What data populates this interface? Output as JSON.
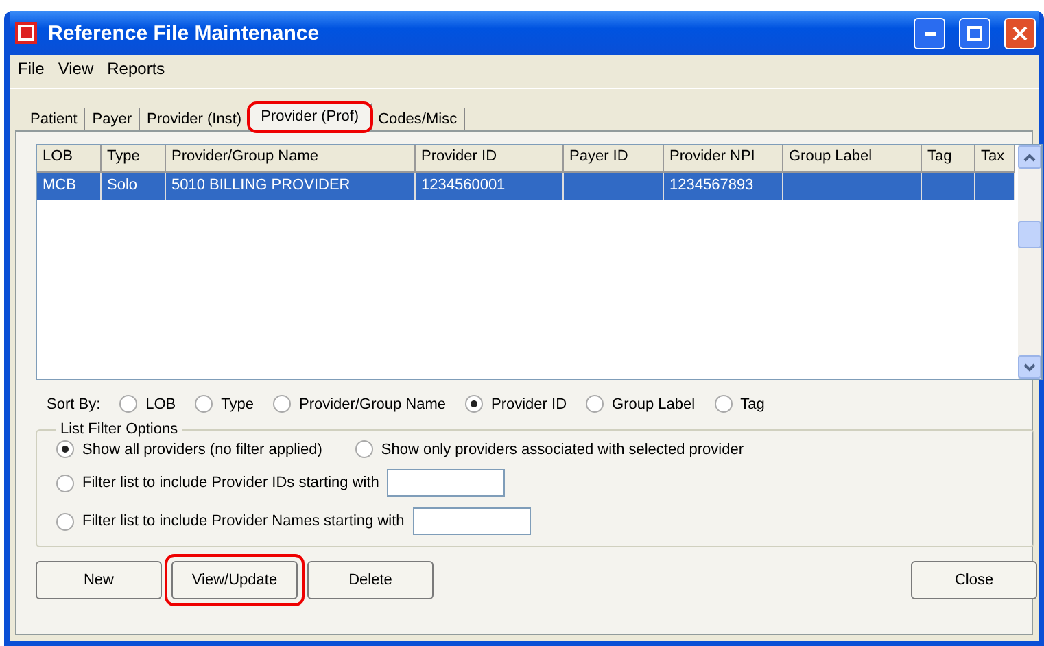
{
  "window": {
    "title": "Reference File Maintenance"
  },
  "menu": [
    "File",
    "View",
    "Reports"
  ],
  "tabs": [
    {
      "label": "Patient",
      "selected": false,
      "highlighted": false
    },
    {
      "label": "Payer",
      "selected": false,
      "highlighted": false
    },
    {
      "label": "Provider (Inst)",
      "selected": false,
      "highlighted": false
    },
    {
      "label": "Provider (Prof)",
      "selected": true,
      "highlighted": true
    },
    {
      "label": "Codes/Misc",
      "selected": false,
      "highlighted": false
    }
  ],
  "table": {
    "columns": [
      "LOB",
      "Type",
      "Provider/Group Name",
      "Provider ID",
      "Payer ID",
      "Provider NPI",
      "Group Label",
      "Tag",
      "Tax"
    ],
    "rows": [
      {
        "selected": true,
        "cells": [
          "MCB",
          "Solo",
          "5010 BILLING PROVIDER",
          "1234560001",
          "",
          "1234567893",
          "",
          "",
          ""
        ]
      }
    ]
  },
  "sort_by": {
    "label": "Sort By:",
    "options": [
      {
        "label": "LOB",
        "selected": false
      },
      {
        "label": "Type",
        "selected": false
      },
      {
        "label": "Provider/Group Name",
        "selected": false
      },
      {
        "label": "Provider ID",
        "selected": true
      },
      {
        "label": "Group Label",
        "selected": false
      },
      {
        "label": "Tag",
        "selected": false
      }
    ]
  },
  "filter": {
    "title": "List Filter Options",
    "options": [
      {
        "label": "Show all providers (no filter applied)",
        "selected": true,
        "kind": "plain"
      },
      {
        "label": "Show only providers associated with selected provider",
        "selected": false,
        "kind": "plain"
      },
      {
        "label": "Filter list to include Provider IDs starting with",
        "selected": false,
        "kind": "input"
      },
      {
        "label": "Filter list to include Provider Names starting with",
        "selected": false,
        "kind": "input"
      }
    ]
  },
  "buttons": [
    {
      "label": "New",
      "highlighted": false
    },
    {
      "label": "View/Update",
      "highlighted": true
    },
    {
      "label": "Delete",
      "highlighted": false
    }
  ],
  "close_button": {
    "label": "Close"
  }
}
